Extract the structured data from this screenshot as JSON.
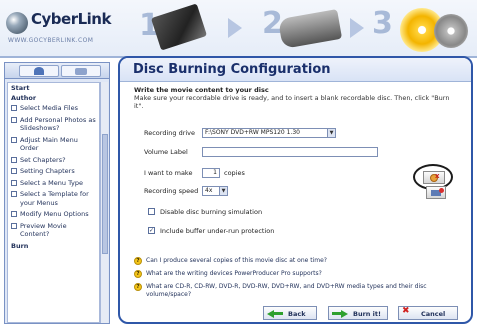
{
  "app": {
    "logo_name": "CyberLink",
    "logo_url": "WWW.GOCYBERLINK.COM"
  },
  "steps": [
    {
      "number": "1",
      "icon": "film-reel-icon"
    },
    {
      "number": "2",
      "icon": "camcorder-icon"
    },
    {
      "number": "3",
      "icon": "disc-icon"
    }
  ],
  "sidebar": {
    "sections": {
      "start": "Start",
      "author": "Author",
      "burn": "Burn"
    },
    "items": [
      "Select Media Files",
      "Add Personal Photos as Slideshows?",
      "Adjust Main Menu Order",
      "Set Chapters?",
      "Setting Chapters",
      "Select a Menu Type",
      "Select a Template for your Menus",
      "Modify Menu Options",
      "Preview Movie Content?"
    ]
  },
  "main": {
    "title": "Disc Burning Configuration",
    "subheading": "Write the movie content to your disc",
    "instructions": "Make sure your recordable drive is ready, and to insert a blank recordable disc. Then, click \"Burn it\".",
    "recording_drive_label": "Recording drive",
    "recording_drive_value": "F:\\SONY DVD+RW MPS120 1.30",
    "volume_label_label": "Volume Label",
    "volume_label_value": "",
    "copies_prefix": "I want to make",
    "copies_value": "1",
    "copies_suffix": "copies",
    "recording_speed_label": "Recording speed",
    "recording_speed_value": "4x",
    "option_simulation": "Disable disc burning simulation",
    "option_simulation_checked": false,
    "option_buffer": "Include buffer under-run protection",
    "option_buffer_checked": true,
    "faq": [
      "Can I produce several copies of this movie disc at one time?",
      "What are the writing devices PowerProducer Pro supports?",
      "What are CD-R, CD-RW, DVD-R, DVD-RW, DVD+RW, and DVD+RW media types and their disc volume/space?"
    ]
  },
  "buttons": {
    "back": "Back",
    "burn": "Burn it!",
    "cancel": "Cancel"
  },
  "colors": {
    "accent": "#2f57a8",
    "title_text": "#1a2f6b",
    "highlight_ring": "#1b1b1b"
  }
}
